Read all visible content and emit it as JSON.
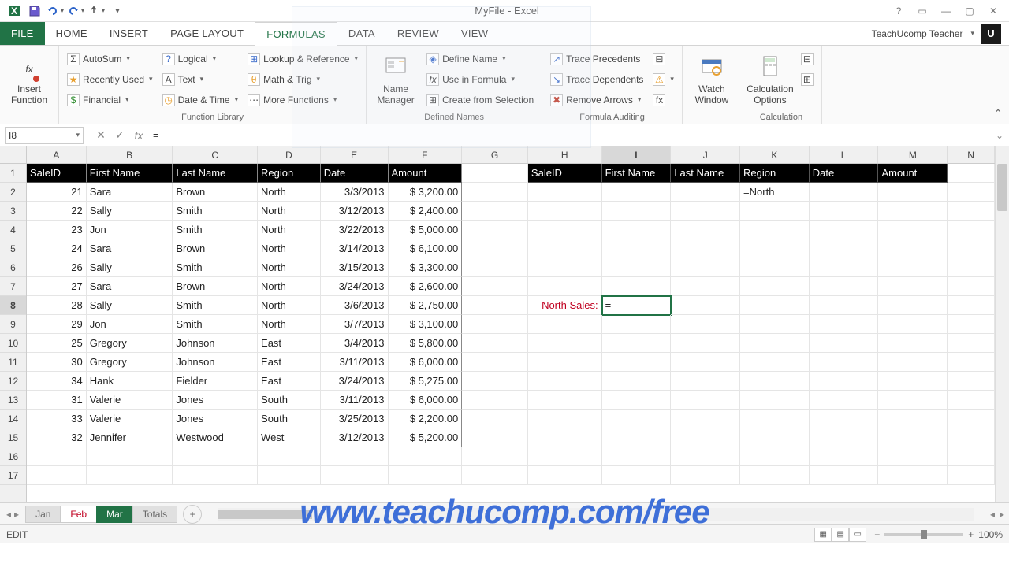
{
  "title": "MyFile - Excel",
  "user": "TeachUcomp Teacher",
  "user_initial": "U",
  "tabs": {
    "file": "FILE",
    "home": "HOME",
    "insert": "INSERT",
    "page": "PAGE LAYOUT",
    "formulas": "FORMULAS",
    "data": "DATA",
    "review": "REVIEW",
    "view": "VIEW"
  },
  "ribbon": {
    "insert_fn": "Insert\nFunction",
    "autosum": "AutoSum",
    "recent": "Recently Used",
    "financial": "Financial",
    "logical": "Logical",
    "text": "Text",
    "date": "Date & Time",
    "lookup": "Lookup & Reference",
    "math": "Math & Trig",
    "more": "More Functions",
    "g_lib": "Function Library",
    "name_mgr": "Name\nManager",
    "define": "Define Name",
    "use": "Use in Formula",
    "create": "Create from Selection",
    "g_names": "Defined Names",
    "trace_p": "Trace Precedents",
    "trace_d": "Trace Dependents",
    "remove": "Remove Arrows",
    "g_audit": "Formula Auditing",
    "watch": "Watch\nWindow",
    "calc": "Calculation\nOptions",
    "g_calc": "Calculation"
  },
  "namebox": "I8",
  "formula": "=",
  "columns": [
    "A",
    "B",
    "C",
    "D",
    "E",
    "F",
    "G",
    "H",
    "I",
    "J",
    "K",
    "L",
    "M",
    "N"
  ],
  "headers1": [
    "SaleID",
    "First Name",
    "Last Name",
    "Region",
    "Date",
    "Amount"
  ],
  "headers2": [
    "SaleID",
    "First Name",
    "Last Name",
    "Region",
    "Date",
    "Amount"
  ],
  "rows": [
    {
      "id": "21",
      "fn": "Sara",
      "ln": "Brown",
      "rg": "North",
      "dt": "3/3/2013",
      "am": "$ 3,200.00"
    },
    {
      "id": "22",
      "fn": "Sally",
      "ln": "Smith",
      "rg": "North",
      "dt": "3/12/2013",
      "am": "$ 2,400.00"
    },
    {
      "id": "23",
      "fn": "Jon",
      "ln": "Smith",
      "rg": "North",
      "dt": "3/22/2013",
      "am": "$ 5,000.00"
    },
    {
      "id": "24",
      "fn": "Sara",
      "ln": "Brown",
      "rg": "North",
      "dt": "3/14/2013",
      "am": "$ 6,100.00"
    },
    {
      "id": "26",
      "fn": "Sally",
      "ln": "Smith",
      "rg": "North",
      "dt": "3/15/2013",
      "am": "$ 3,300.00"
    },
    {
      "id": "27",
      "fn": "Sara",
      "ln": "Brown",
      "rg": "North",
      "dt": "3/24/2013",
      "am": "$ 2,600.00"
    },
    {
      "id": "28",
      "fn": "Sally",
      "ln": "Smith",
      "rg": "North",
      "dt": "3/6/2013",
      "am": "$ 2,750.00"
    },
    {
      "id": "29",
      "fn": "Jon",
      "ln": "Smith",
      "rg": "North",
      "dt": "3/7/2013",
      "am": "$ 3,100.00"
    },
    {
      "id": "25",
      "fn": "Gregory",
      "ln": "Johnson",
      "rg": "East",
      "dt": "3/4/2013",
      "am": "$ 5,800.00"
    },
    {
      "id": "30",
      "fn": "Gregory",
      "ln": "Johnson",
      "rg": "East",
      "dt": "3/11/2013",
      "am": "$ 6,000.00"
    },
    {
      "id": "34",
      "fn": "Hank",
      "ln": "Fielder",
      "rg": "East",
      "dt": "3/24/2013",
      "am": "$ 5,275.00"
    },
    {
      "id": "31",
      "fn": "Valerie",
      "ln": "Jones",
      "rg": "South",
      "dt": "3/11/2013",
      "am": "$ 6,000.00"
    },
    {
      "id": "33",
      "fn": "Valerie",
      "ln": "Jones",
      "rg": "South",
      "dt": "3/25/2013",
      "am": "$ 2,200.00"
    },
    {
      "id": "32",
      "fn": "Jennifer",
      "ln": "Westwood",
      "rg": "West",
      "dt": "3/12/2013",
      "am": "$ 5,200.00"
    }
  ],
  "k2": "=North",
  "h8": "North Sales:",
  "i8": "=",
  "sheet_tabs": {
    "jan": "Jan",
    "feb": "Feb",
    "mar": "Mar",
    "totals": "Totals"
  },
  "status": "EDIT",
  "zoom": "100%",
  "watermark": "www.teachucomp.com/free"
}
